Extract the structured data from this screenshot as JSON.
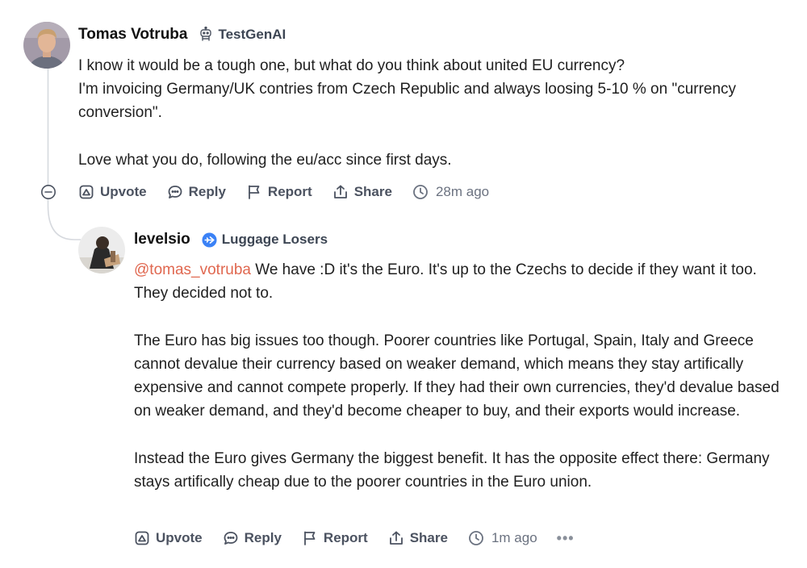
{
  "comments": [
    {
      "author": "Tomas Votruba",
      "badge_label": "TestGenAI",
      "badge_icon": "robot-icon",
      "paragraphs": [
        "I know it would be a tough one, but what do you think about united EU currency?",
        "I'm invoicing Germany/UK contries from Czech Republic and always loosing 5-10 % on \"currency conversion\".",
        "Love what you do, following the eu/acc since first days."
      ],
      "actions": {
        "upvote": "Upvote",
        "reply": "Reply",
        "report": "Report",
        "share": "Share",
        "time": "28m ago"
      }
    },
    {
      "author": "levelsio",
      "badge_label": "Luggage Losers",
      "badge_icon": "airplane-icon",
      "badge_color": "#3b82f6",
      "mention": "@tomas_votruba",
      "mention_color": "#e0674f",
      "first_paragraph_rest": " We have :D it's the Euro. It's up to the Czechs to decide if they want it too. They decided not to.",
      "paragraphs": [
        "The Euro has big issues too though. Poorer countries like Portugal, Spain, Italy and Greece cannot devalue their currency based on weaker demand, which means they stay artifically expensive and cannot compete properly. If they had their own currencies, they'd devalue based on weaker demand, and they'd become cheaper to buy, and their exports would increase.",
        "Instead the Euro gives Germany the biggest benefit. It has the opposite effect there: Germany stays artifically cheap due to the poorer countries in the Euro union."
      ],
      "actions": {
        "upvote": "Upvote",
        "reply": "Reply",
        "report": "Report",
        "share": "Share",
        "time": "1m ago",
        "more": "•••"
      }
    }
  ]
}
